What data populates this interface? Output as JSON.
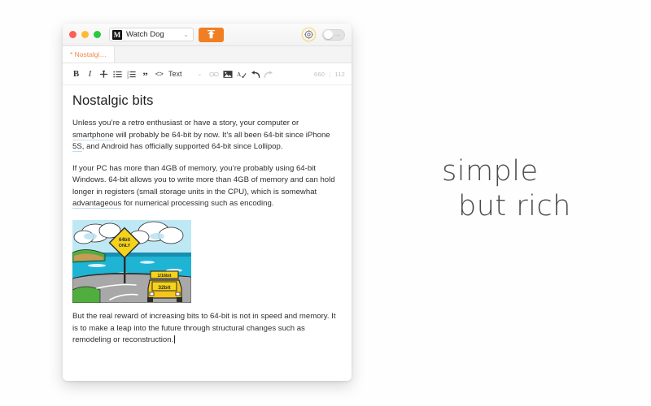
{
  "window": {
    "traffic_lights": [
      "close",
      "minimize",
      "zoom"
    ],
    "publication": {
      "logo_letter": "M",
      "name": "Watch Dog",
      "chevron": "⌄"
    },
    "publish_button": {
      "icon": "upload-icon"
    },
    "settings_icon": "gear-icon",
    "preview_toggle": {
      "state": "off",
      "arrow": "→"
    }
  },
  "tabs": [
    {
      "label": "* Nostalgi…",
      "active": true
    }
  ],
  "toolbar": {
    "bold": "B",
    "italic": "I",
    "strikethrough": "strikethrough-icon",
    "bullet_list": "bullet-list-icon",
    "numbered_list": "numbered-list-icon",
    "quote": "”",
    "code": "<>",
    "style_label": "Text",
    "style_chevron": "⌄",
    "link": "link-icon",
    "image": "image-icon",
    "spellcheck": "spellcheck-icon",
    "undo": "undo-icon",
    "redo": "redo-icon",
    "counter": "660 ⋮ 112"
  },
  "document": {
    "title": "Nostalgic bits",
    "paragraphs": [
      {
        "id": "p1",
        "runs": [
          {
            "text": "Unless you’re a retro enthusiast or have a story, your computer or ",
            "link": false
          },
          {
            "text": "smartphone",
            "link": true
          },
          {
            "text": " will probably be 64-bit by now. It’s all been 64-bit since iPhone ",
            "link": false
          },
          {
            "text": "5S",
            "link": true
          },
          {
            "text": ", and Android has officially supported 64-bit since Lollipop.",
            "link": false
          }
        ]
      },
      {
        "id": "p2",
        "runs": [
          {
            "text": "If your PC has more than 4GB of memory, you’re probably using 64-bit Windows. 64-bit allows you to write more than 4GB of memory and can hold longer in registers (small storage units in the CPU), which is somewhat ",
            "link": false
          },
          {
            "text": "advantageous",
            "link": true
          },
          {
            "text": " for numerical processing such as encoding.",
            "link": false
          }
        ]
      },
      {
        "id": "p3",
        "runs": [
          {
            "text": "But the real reward of increasing bits to 64-bit is not in speed and memory. It is to make a leap into the future through structural changes such as remodeling or reconstruction.",
            "link": false
          }
        ],
        "caret_after": true
      }
    ],
    "figure": {
      "name": "cartoon-road-sign-illustration",
      "sign_text_line1": "64bit",
      "sign_text_line2": "ONLY",
      "car_roof_text": "1/16bit",
      "car_body_text": "32bit"
    }
  },
  "tagline": {
    "line1": "simple",
    "line2": "but rich"
  },
  "colors": {
    "accent_orange": "#f07f23",
    "tab_orange": "#ef8b45",
    "link_underline": "#bfdcf2",
    "text": "#2e2e2e",
    "page_bg": "#fefefe"
  }
}
